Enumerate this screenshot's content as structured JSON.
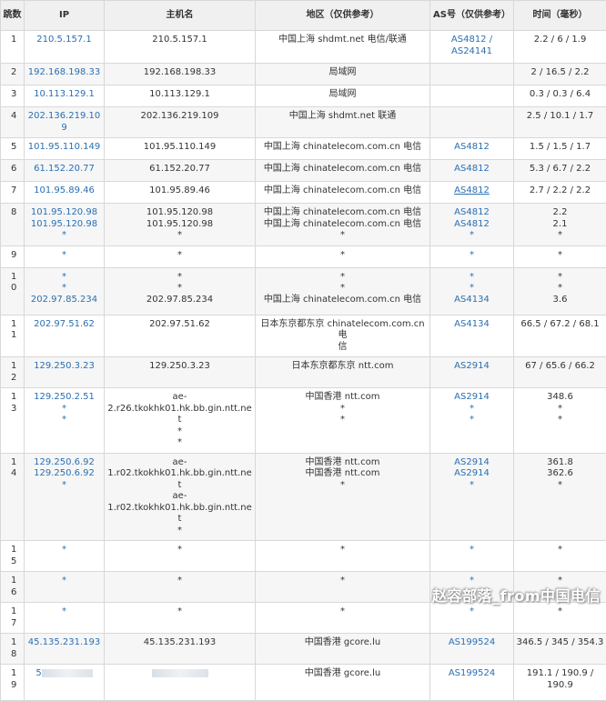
{
  "headers": {
    "hop": "跳数",
    "ip": "IP",
    "host": "主机名",
    "region": "地区（仅供参考）",
    "asn": "AS号（仅供参考）",
    "time": "时间（毫秒）"
  },
  "rows": [
    {
      "hop": "1",
      "ip": [
        "210.5.157.1"
      ],
      "host": [
        "210.5.157.1"
      ],
      "region": [
        "中国上海 shdmt.net 电信/联通"
      ],
      "asn": [
        "AS4812 /",
        "AS24141"
      ],
      "time": [
        "2.2 / 6 / 1.9"
      ],
      "h": 36
    },
    {
      "hop": "2",
      "ip": [
        "192.168.198.33"
      ],
      "host": [
        "192.168.198.33"
      ],
      "region": [
        "局域网"
      ],
      "asn": [
        ""
      ],
      "time": [
        "2 / 16.5 / 2.2"
      ],
      "h": 24
    },
    {
      "hop": "3",
      "ip": [
        "10.113.129.1"
      ],
      "host": [
        "10.113.129.1"
      ],
      "region": [
        "局域网"
      ],
      "asn": [
        ""
      ],
      "time": [
        "0.3 / 0.3 / 6.4"
      ],
      "h": 24
    },
    {
      "hop": "4",
      "ip": [
        "202.136.219.109"
      ],
      "host": [
        "202.136.219.109"
      ],
      "region": [
        "中国上海 shdmt.net 联通"
      ],
      "asn": [
        ""
      ],
      "time": [
        "2.5 / 10.1 / 1.7"
      ],
      "h": 24
    },
    {
      "hop": "5",
      "ip": [
        "101.95.110.149"
      ],
      "host": [
        "101.95.110.149"
      ],
      "region": [
        "中国上海 chinatelecom.com.cn 电信"
      ],
      "asn": [
        "AS4812"
      ],
      "time": [
        "1.5 / 1.5 / 1.7"
      ],
      "h": 24
    },
    {
      "hop": "6",
      "ip": [
        "61.152.20.77"
      ],
      "host": [
        "61.152.20.77"
      ],
      "region": [
        "中国上海 chinatelecom.com.cn 电信"
      ],
      "asn": [
        "AS4812"
      ],
      "time": [
        "5.3 / 6.7 / 2.2"
      ],
      "h": 24
    },
    {
      "hop": "7",
      "ip": [
        "101.95.89.46"
      ],
      "host": [
        "101.95.89.46"
      ],
      "region": [
        "中国上海 chinatelecom.com.cn 电信"
      ],
      "asn": [
        "AS4812"
      ],
      "time": [
        "2.7 / 2.2 / 2.2"
      ],
      "h": 24,
      "underline": true
    },
    {
      "hop": "8",
      "ip": [
        "101.95.120.98",
        "101.95.120.98",
        "*"
      ],
      "host": [
        "101.95.120.98",
        "101.95.120.98",
        "*"
      ],
      "region": [
        "中国上海 chinatelecom.com.cn 电信",
        "中国上海 chinatelecom.com.cn 电信",
        "*"
      ],
      "asn": [
        "AS4812",
        "AS4812",
        "*"
      ],
      "time": [
        "2.2",
        "2.1",
        "*"
      ],
      "h": 44
    },
    {
      "hop": "9",
      "ip": [
        "*"
      ],
      "host": [
        "*"
      ],
      "region": [
        "*"
      ],
      "asn": [
        "*"
      ],
      "time": [
        "*"
      ],
      "h": 24
    },
    {
      "hop": "10",
      "ip": [
        "*",
        "*",
        "202.97.85.234"
      ],
      "host": [
        "*",
        "*",
        "202.97.85.234"
      ],
      "region": [
        "*",
        "*",
        "中国上海 chinatelecom.com.cn 电信"
      ],
      "asn": [
        "*",
        "*",
        "AS4134"
      ],
      "time": [
        "*",
        "*",
        "3.6"
      ],
      "h": 52
    },
    {
      "hop": "11",
      "ip": [
        "202.97.51.62"
      ],
      "host": [
        "202.97.51.62"
      ],
      "region": [
        "日本东京都东京 chinatelecom.com.cn 电",
        "信"
      ],
      "asn": [
        "AS4134"
      ],
      "time": [
        "66.5 / 67.2 / 68.1"
      ],
      "h": 36
    },
    {
      "hop": "12",
      "ip": [
        "129.250.3.23"
      ],
      "host": [
        "129.250.3.23"
      ],
      "region": [
        "日本东京都东京 ntt.com"
      ],
      "asn": [
        "AS2914"
      ],
      "time": [
        "67 / 65.6 / 66.2"
      ],
      "h": 24
    },
    {
      "hop": "13",
      "ip": [
        "129.250.2.51",
        "*",
        "*"
      ],
      "host": [
        "ae-",
        "2.r26.tkokhk01.hk.bb.gin.ntt.net",
        "*",
        "*"
      ],
      "region": [
        "中国香港 ntt.com",
        "*",
        "*"
      ],
      "asn": [
        "AS2914",
        "*",
        "*"
      ],
      "time": [
        "348.6",
        "*",
        "*"
      ],
      "h": 62
    },
    {
      "hop": "14",
      "ip": [
        "129.250.6.92",
        "129.250.6.92",
        "*"
      ],
      "host": [
        "ae-",
        "1.r02.tkokhk01.hk.bb.gin.ntt.net",
        "ae-",
        "1.r02.tkokhk01.hk.bb.gin.ntt.net",
        "*"
      ],
      "region": [
        "中国香港 ntt.com",
        "中国香港 ntt.com",
        "*"
      ],
      "asn": [
        "AS2914",
        "AS2914",
        "*"
      ],
      "time": [
        "361.8",
        "362.6",
        "*"
      ],
      "h": 74
    },
    {
      "hop": "15",
      "ip": [
        "*"
      ],
      "host": [
        "*"
      ],
      "region": [
        "*"
      ],
      "asn": [
        "*"
      ],
      "time": [
        "*"
      ],
      "h": 24
    },
    {
      "hop": "16",
      "ip": [
        "*"
      ],
      "host": [
        "*"
      ],
      "region": [
        "*"
      ],
      "asn": [
        "*"
      ],
      "time": [
        "*"
      ],
      "h": 24
    },
    {
      "hop": "17",
      "ip": [
        "*"
      ],
      "host": [
        "*"
      ],
      "region": [
        "*"
      ],
      "asn": [
        "*"
      ],
      "time": [
        "*"
      ],
      "h": 24
    },
    {
      "hop": "18",
      "ip": [
        "45.135.231.193"
      ],
      "host": [
        "45.135.231.193"
      ],
      "region": [
        "中国香港 gcore.lu"
      ],
      "asn": [
        "AS199524"
      ],
      "time": [
        "346.5 / 345 / 354.3"
      ],
      "h": 24
    },
    {
      "hop": "19",
      "ip": [
        "5"
      ],
      "host": [
        ""
      ],
      "region": [
        "中国香港 gcore.lu"
      ],
      "asn": [
        "AS199524"
      ],
      "time": [
        "191.1 / 190.9 /",
        "190.9"
      ],
      "h": 40,
      "redacted": true
    }
  ],
  "watermark": "赵容部落_from中国电信"
}
